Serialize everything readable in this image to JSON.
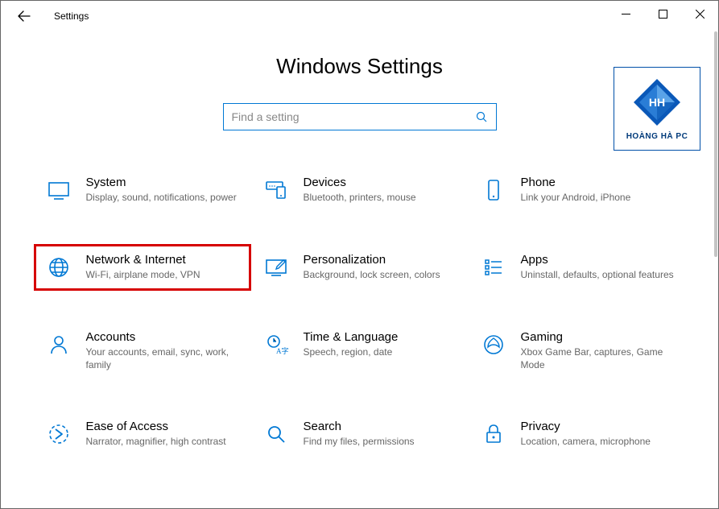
{
  "window": {
    "title": "Settings"
  },
  "page": {
    "heading": "Windows Settings"
  },
  "search": {
    "placeholder": "Find a setting"
  },
  "logo": {
    "caption": "HOÀNG HÀ PC"
  },
  "tiles": [
    {
      "id": "system",
      "title": "System",
      "desc": "Display, sound, notifications, power",
      "highlight": false
    },
    {
      "id": "devices",
      "title": "Devices",
      "desc": "Bluetooth, printers, mouse",
      "highlight": false
    },
    {
      "id": "phone",
      "title": "Phone",
      "desc": "Link your Android, iPhone",
      "highlight": false
    },
    {
      "id": "network",
      "title": "Network & Internet",
      "desc": "Wi-Fi, airplane mode, VPN",
      "highlight": true
    },
    {
      "id": "personalization",
      "title": "Personalization",
      "desc": "Background, lock screen, colors",
      "highlight": false
    },
    {
      "id": "apps",
      "title": "Apps",
      "desc": "Uninstall, defaults, optional features",
      "highlight": false
    },
    {
      "id": "accounts",
      "title": "Accounts",
      "desc": "Your accounts, email, sync, work, family",
      "highlight": false
    },
    {
      "id": "time",
      "title": "Time & Language",
      "desc": "Speech, region, date",
      "highlight": false
    },
    {
      "id": "gaming",
      "title": "Gaming",
      "desc": "Xbox Game Bar, captures, Game Mode",
      "highlight": false
    },
    {
      "id": "ease",
      "title": "Ease of Access",
      "desc": "Narrator, magnifier, high contrast",
      "highlight": false
    },
    {
      "id": "search",
      "title": "Search",
      "desc": "Find my files, permissions",
      "highlight": false
    },
    {
      "id": "privacy",
      "title": "Privacy",
      "desc": "Location, camera, microphone",
      "highlight": false
    }
  ],
  "colors": {
    "accent": "#0078d4",
    "highlight_border": "#d60000",
    "logo_border": "#0050a8"
  }
}
